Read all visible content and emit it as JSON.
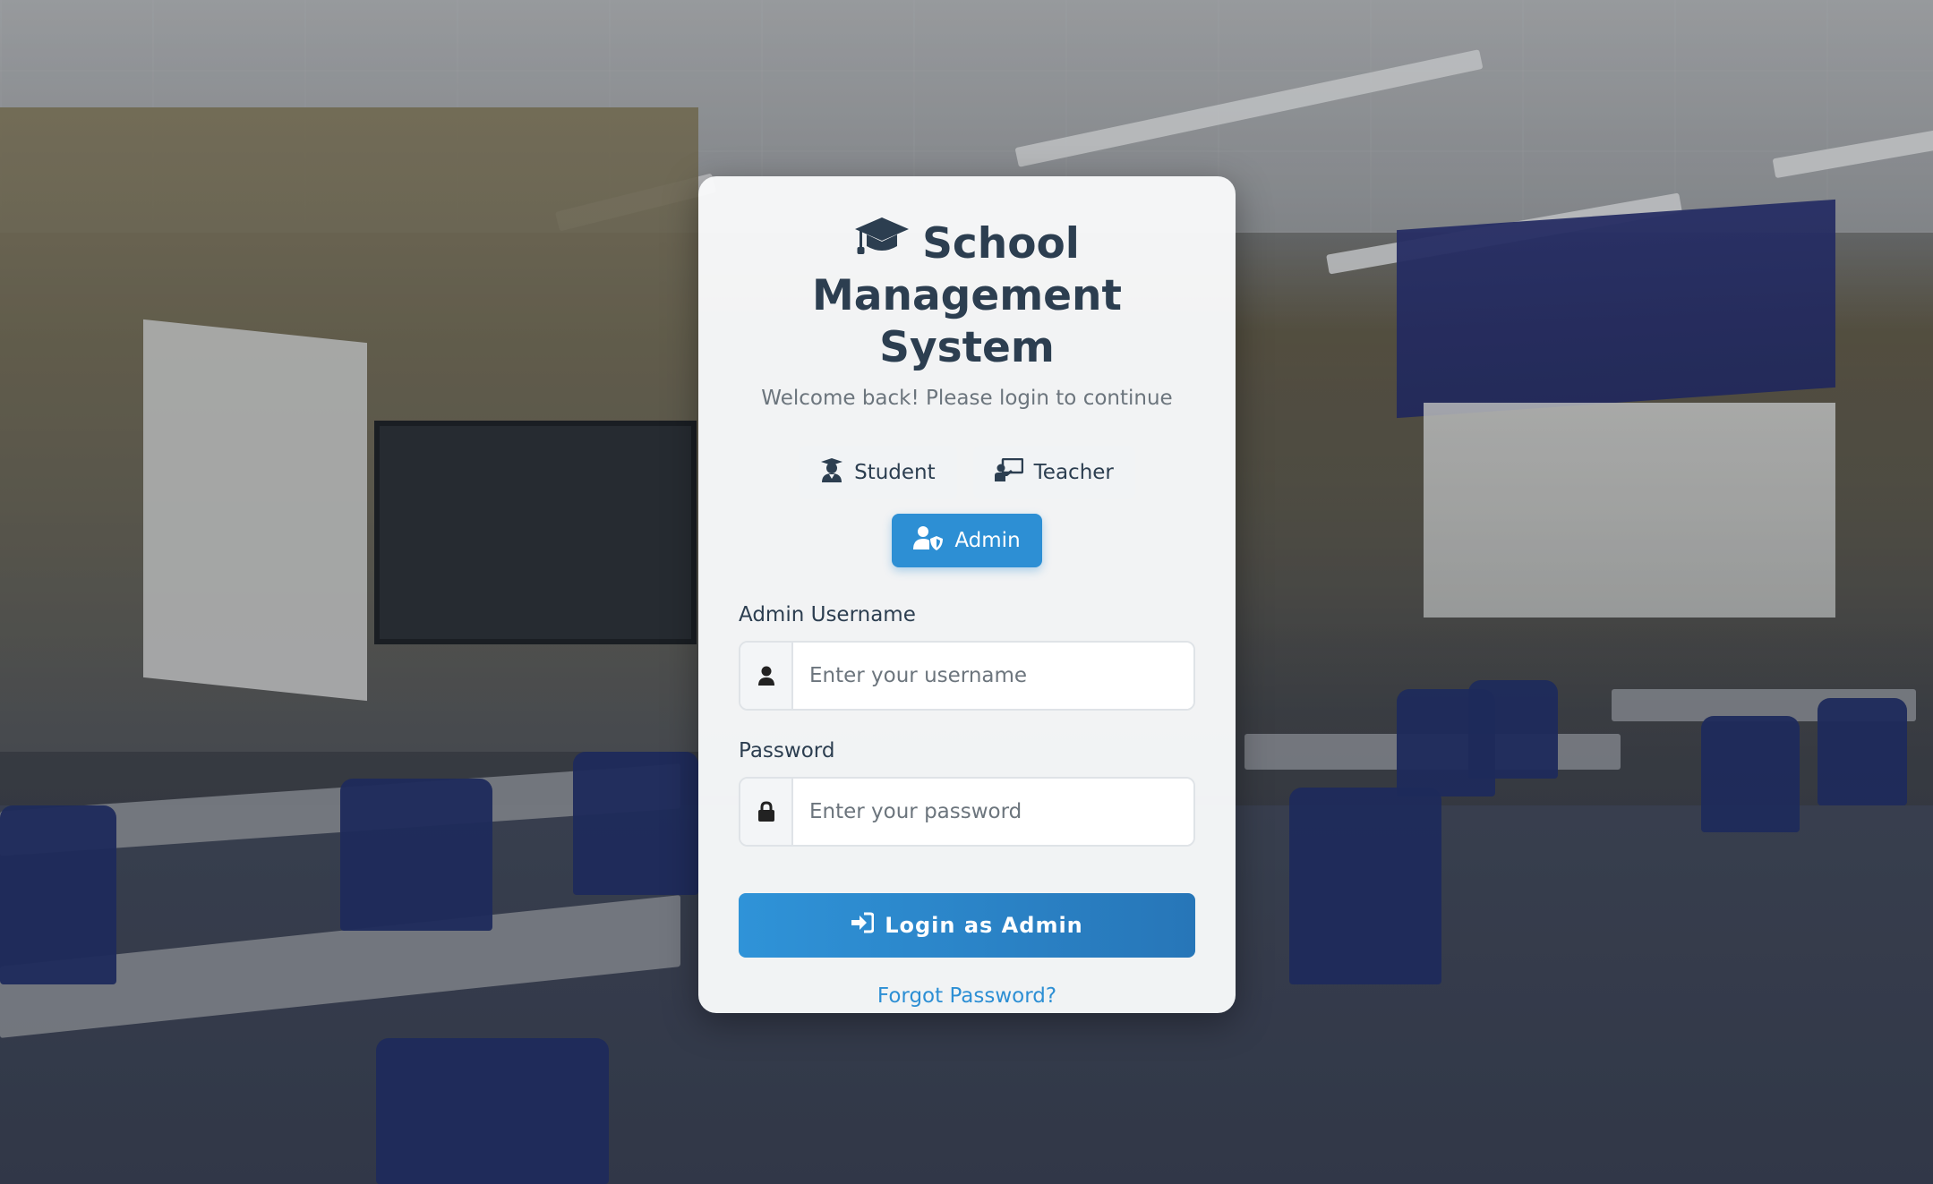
{
  "app": {
    "title_line1": "School",
    "title_line2": "Management System",
    "subtitle": "Welcome back! Please login to continue"
  },
  "roles": [
    {
      "label": "Student",
      "icon": "user-graduate-icon",
      "active": false
    },
    {
      "label": "Teacher",
      "icon": "chalkboard-teacher-icon",
      "active": false
    },
    {
      "label": "Admin",
      "icon": "user-shield-icon",
      "active": true
    }
  ],
  "form": {
    "username_label": "Admin Username",
    "username_placeholder": "Enter your username",
    "password_label": "Password",
    "password_placeholder": "Enter your password",
    "submit_label": "Login as Admin",
    "forgot_label": "Forgot Password?"
  },
  "colors": {
    "primary": "#2d8fd4",
    "heading": "#2c3e50",
    "muted": "#6c757d"
  }
}
